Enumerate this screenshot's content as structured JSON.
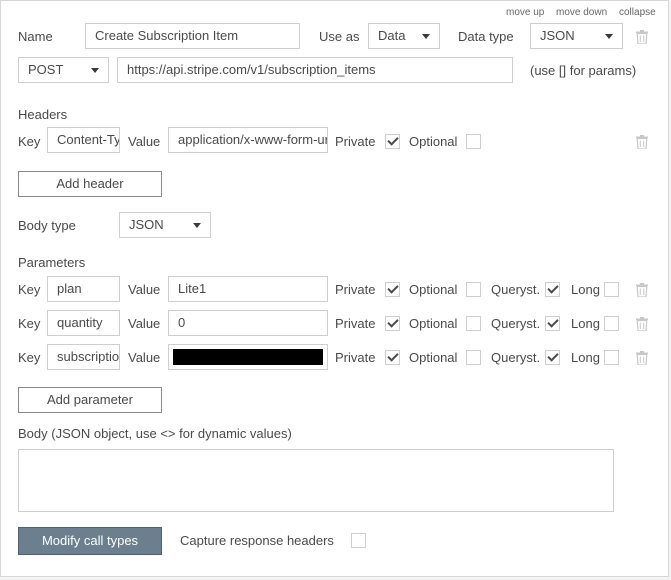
{
  "top_actions": {
    "move_up": "move up",
    "move_down": "move down",
    "collapse": "collapse"
  },
  "call": {
    "name_label": "Name",
    "name_value": "Create Subscription Item",
    "use_as_label": "Use as",
    "use_as_value": "Data",
    "data_type_label": "Data type",
    "data_type_value": "JSON",
    "method_value": "POST",
    "url_value": "https://api.stripe.com/v1/subscription_items",
    "url_hint": "(use [] for params)"
  },
  "headers": {
    "section_label": "Headers",
    "rows": [
      {
        "key_label": "Key",
        "key_value": "Content-Type",
        "value_label": "Value",
        "value_value": "application/x-www-form-urlencoded",
        "private_label": "Private",
        "private_checked": true,
        "optional_label": "Optional",
        "optional_checked": false
      }
    ],
    "add_button": "Add header"
  },
  "body_type": {
    "label": "Body type",
    "value": "JSON"
  },
  "parameters": {
    "section_label": "Parameters",
    "rows": [
      {
        "key_label": "Key",
        "key_value": "plan",
        "value_label": "Value",
        "value_value": "Lite1",
        "private_label": "Private",
        "private_checked": true,
        "optional_label": "Optional",
        "optional_checked": false,
        "queryst_label": "Queryst.",
        "queryst_checked": true,
        "long_label": "Long",
        "long_checked": false
      },
      {
        "key_label": "Key",
        "key_value": "quantity",
        "value_label": "Value",
        "value_value": "0",
        "private_label": "Private",
        "private_checked": true,
        "optional_label": "Optional",
        "optional_checked": false,
        "queryst_label": "Queryst.",
        "queryst_checked": true,
        "long_label": "Long",
        "long_checked": false
      },
      {
        "key_label": "Key",
        "key_value": "subscription",
        "value_label": "Value",
        "value_value": "",
        "value_masked": true,
        "private_label": "Private",
        "private_checked": true,
        "optional_label": "Optional",
        "optional_checked": false,
        "queryst_label": "Queryst.",
        "queryst_checked": true,
        "long_label": "Long",
        "long_checked": false
      }
    ],
    "add_button": "Add parameter"
  },
  "body": {
    "label": "Body (JSON object, use <> for dynamic values)",
    "value": ""
  },
  "footer": {
    "modify_button": "Modify call types",
    "capture_label": "Capture response headers",
    "capture_checked": false
  },
  "icons": {
    "delete": "trash-icon",
    "dropdown": "chevron-down-icon",
    "check": "check-icon"
  },
  "colors": {
    "primary_button": "#6b7f8e",
    "border": "#cfcfcf",
    "text": "#4a4a4a",
    "trash": "#c8c8c8"
  }
}
